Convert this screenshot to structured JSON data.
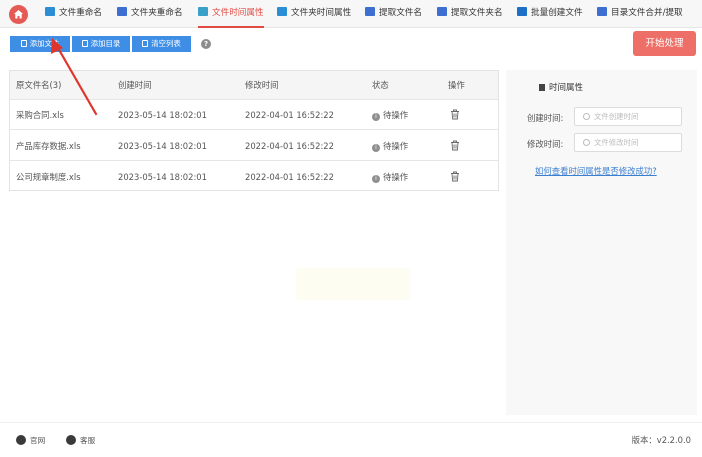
{
  "tabs": [
    {
      "label": "文件重命名",
      "icon": "rename-icon",
      "color": "#2c8fd6"
    },
    {
      "label": "文件夹重命名",
      "icon": "folder-rename-icon",
      "color": "#3c6fd0"
    },
    {
      "label": "文件时间属性",
      "icon": "file-time-icon",
      "color": "#3aa0c8",
      "active": true
    },
    {
      "label": "文件夹时间属性",
      "icon": "folder-time-icon",
      "color": "#2c8fd6"
    },
    {
      "label": "提取文件名",
      "icon": "extract-name-icon",
      "color": "#3c6fd0"
    },
    {
      "label": "提取文件夹名",
      "icon": "extract-folder-icon",
      "color": "#3c6fd0"
    },
    {
      "label": "批量创建文件",
      "icon": "batch-create-icon",
      "color": "#1d70c5"
    },
    {
      "label": "目录文件合并/提取",
      "icon": "merge-icon",
      "color": "#3c6fd0"
    }
  ],
  "toolbar": {
    "add_file": "添加文件",
    "add_folder": "添加目录",
    "clear_list": "清空列表",
    "help": "?",
    "start": "开始处理"
  },
  "table": {
    "columns": [
      "原文件名(3)",
      "创建时间",
      "修改时间",
      "状态",
      "操作"
    ],
    "rows": [
      {
        "name": "采购合同.xls",
        "created": "2023-05-14 18:02:01",
        "modified": "2022-04-01 16:52:22",
        "status": "待操作"
      },
      {
        "name": "产品库存数据.xls",
        "created": "2023-05-14 18:02:01",
        "modified": "2022-04-01 16:52:22",
        "status": "待操作"
      },
      {
        "name": "公司规章制度.xls",
        "created": "2023-05-14 18:02:01",
        "modified": "2022-04-01 16:52:22",
        "status": "待操作"
      }
    ]
  },
  "time_panel": {
    "title": "时间属性",
    "created_label": "创建时间:",
    "created_placeholder": "文件创建时间",
    "modified_label": "修改时间:",
    "modified_placeholder": "文件修改时间",
    "help_link": "如何查看时间属性是否修改成功?"
  },
  "footer": {
    "website": "官网",
    "support": "客服",
    "version": "版本：v2.2.0.0"
  },
  "colors": {
    "accent_red": "#e04c44",
    "button_blue": "#3f8ee6",
    "start_button": "#ee6f67",
    "arrow": "#e0352b"
  }
}
